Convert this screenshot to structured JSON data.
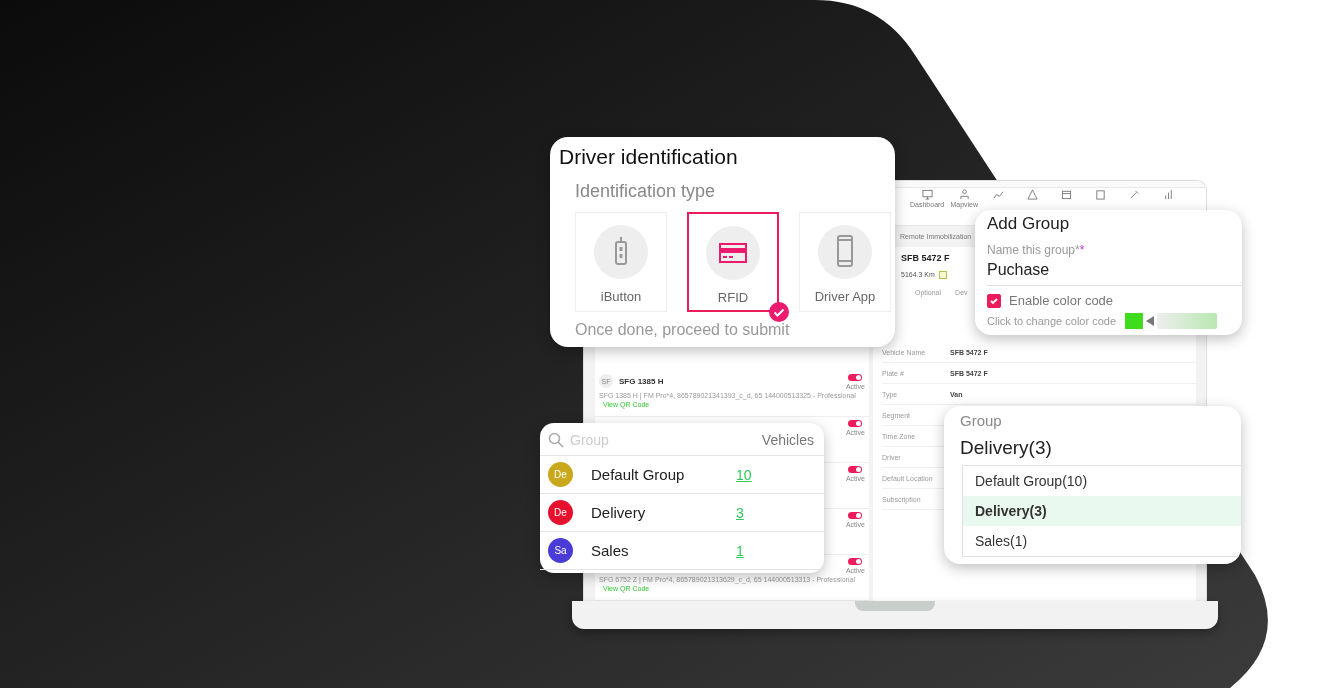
{
  "driver_identification": {
    "title": "Driver identification",
    "subtitle": "Identification type",
    "options": [
      {
        "label": "iButton",
        "kind": "fob",
        "selected": false
      },
      {
        "label": "RFID",
        "kind": "card",
        "selected": true
      },
      {
        "label": "Driver App",
        "kind": "phone",
        "selected": false
      }
    ],
    "hint": "Once done, proceed to submit"
  },
  "laptop": {
    "toolbar": [
      {
        "label": "Dashboard",
        "kind": "monitor"
      },
      {
        "label": "Mapview",
        "kind": "people"
      },
      {
        "kind": "chart"
      },
      {
        "kind": "alert"
      },
      {
        "kind": "calendar"
      },
      {
        "kind": "box"
      },
      {
        "kind": "tool"
      },
      {
        "kind": "bars"
      }
    ],
    "subtab": "Remote Immobilization",
    "vehicle": {
      "plate": "SFB 5472 F",
      "odometer": "5164.3 Km",
      "tabs": [
        "Optional",
        "Dev"
      ]
    },
    "details": [
      {
        "label": "Vehicle Name",
        "value": "SFB 5472 F"
      },
      {
        "label": "Plate #",
        "value": "SFB 5472 F"
      },
      {
        "label": "Type",
        "value": "Van"
      },
      {
        "label": "Segment"
      },
      {
        "label": "Time Zone"
      },
      {
        "label": "Driver"
      },
      {
        "label": "Default Location"
      },
      {
        "label": "Subscription"
      }
    ],
    "vehicles": [
      {
        "badge": "SF",
        "name": "SFG 1385 H",
        "detail": "SFG 1385 H  |  FM Pro*4, 865789021341393_c_d, 65 144000513325  - Professional",
        "link": "View QR Code",
        "status": "Active",
        "on": true
      },
      {
        "status": "Active",
        "on": true
      },
      {
        "status": "Active",
        "on": true
      },
      {
        "status": "Active",
        "on": true
      },
      {
        "detail": "SFG 6752 Z  |  FM Pro*4, 865789021313629_c_d, 65 144000513313  - Professional",
        "link": "View QR Code",
        "status": "Active",
        "on": true
      }
    ]
  },
  "add_group": {
    "title": "Add Group",
    "field_label": "Name this group*",
    "required_mark": "*",
    "value": "Puchase",
    "checkbox": {
      "label": "Enable color code",
      "checked": true
    },
    "color_hint": "Click to change color code",
    "color": "#3fdc1e"
  },
  "group_list": {
    "search_placeholder": "Group",
    "column": "Vehicles",
    "rows": [
      {
        "avatar": "De",
        "color": "#c9a81c",
        "name": "Default Group",
        "count": "10"
      },
      {
        "avatar": "De",
        "color": "#e8112d",
        "name": "Delivery",
        "count": "3"
      },
      {
        "avatar": "Sa",
        "color": "#4a3bd6",
        "name": "Sales",
        "count": "1"
      }
    ]
  },
  "group_select": {
    "label": "Group",
    "value": "Delivery(3)",
    "options": [
      {
        "label": "Default Group(10)",
        "selected": false
      },
      {
        "label": "Delivery(3)",
        "selected": true
      },
      {
        "label": "Sales(1)",
        "selected": false
      }
    ]
  }
}
